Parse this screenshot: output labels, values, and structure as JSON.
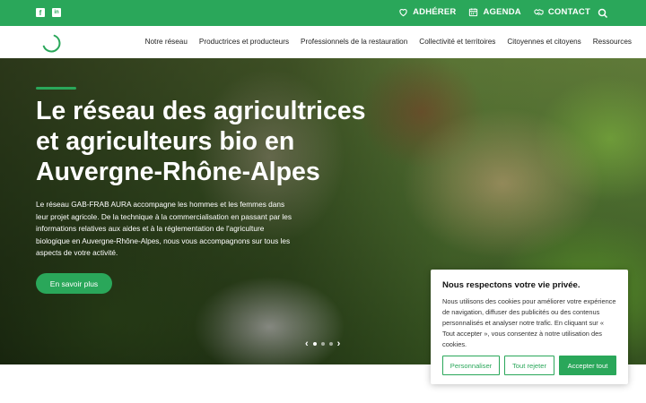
{
  "topbar": {
    "social": [
      {
        "name": "facebook-icon",
        "glyph": "f"
      },
      {
        "name": "linkedin-icon",
        "glyph": "in"
      }
    ],
    "links": [
      {
        "label": "ADHÉRER",
        "icon": "heart-icon"
      },
      {
        "label": "AGENDA",
        "icon": "calendar-icon"
      },
      {
        "label": "CONTACT",
        "icon": "handshake-icon"
      }
    ],
    "search_icon": "search-icon"
  },
  "nav": {
    "items": [
      "Notre réseau",
      "Productrices et producteurs",
      "Professionnels de la restauration",
      "Collectivité et territoires",
      "Citoyennes et citoyens",
      "Ressources"
    ]
  },
  "hero": {
    "title": "Le réseau des agricultrices et agriculteurs bio en Auvergne-Rhône-Alpes",
    "text": "Le réseau GAB-FRAB AURA accompagne les hommes et les femmes dans leur projet agricole. De la technique à la commercialisation en passant par les informations relatives aux aides et à la réglementation de l'agriculture biologique en Auvergne-Rhône-Alpes, nous vous accompagnons sur tous les aspects de votre activité.",
    "button": "En savoir plus",
    "slider": {
      "prev": "‹",
      "next": "›",
      "dots": 3,
      "active": 0
    }
  },
  "cookie": {
    "title": "Nous respectons votre vie privée.",
    "body": "Nous utilisons des cookies pour améliorer votre expérience de navigation, diffuser des publicités ou des contenus personnalisés et analyser notre trafic. En cliquant sur « Tout accepter », vous consentez à notre utilisation des cookies.",
    "customize": "Personnaliser",
    "reject": "Tout rejeter",
    "accept": "Accepter tout"
  },
  "colors": {
    "brand": "#2aa75a"
  }
}
